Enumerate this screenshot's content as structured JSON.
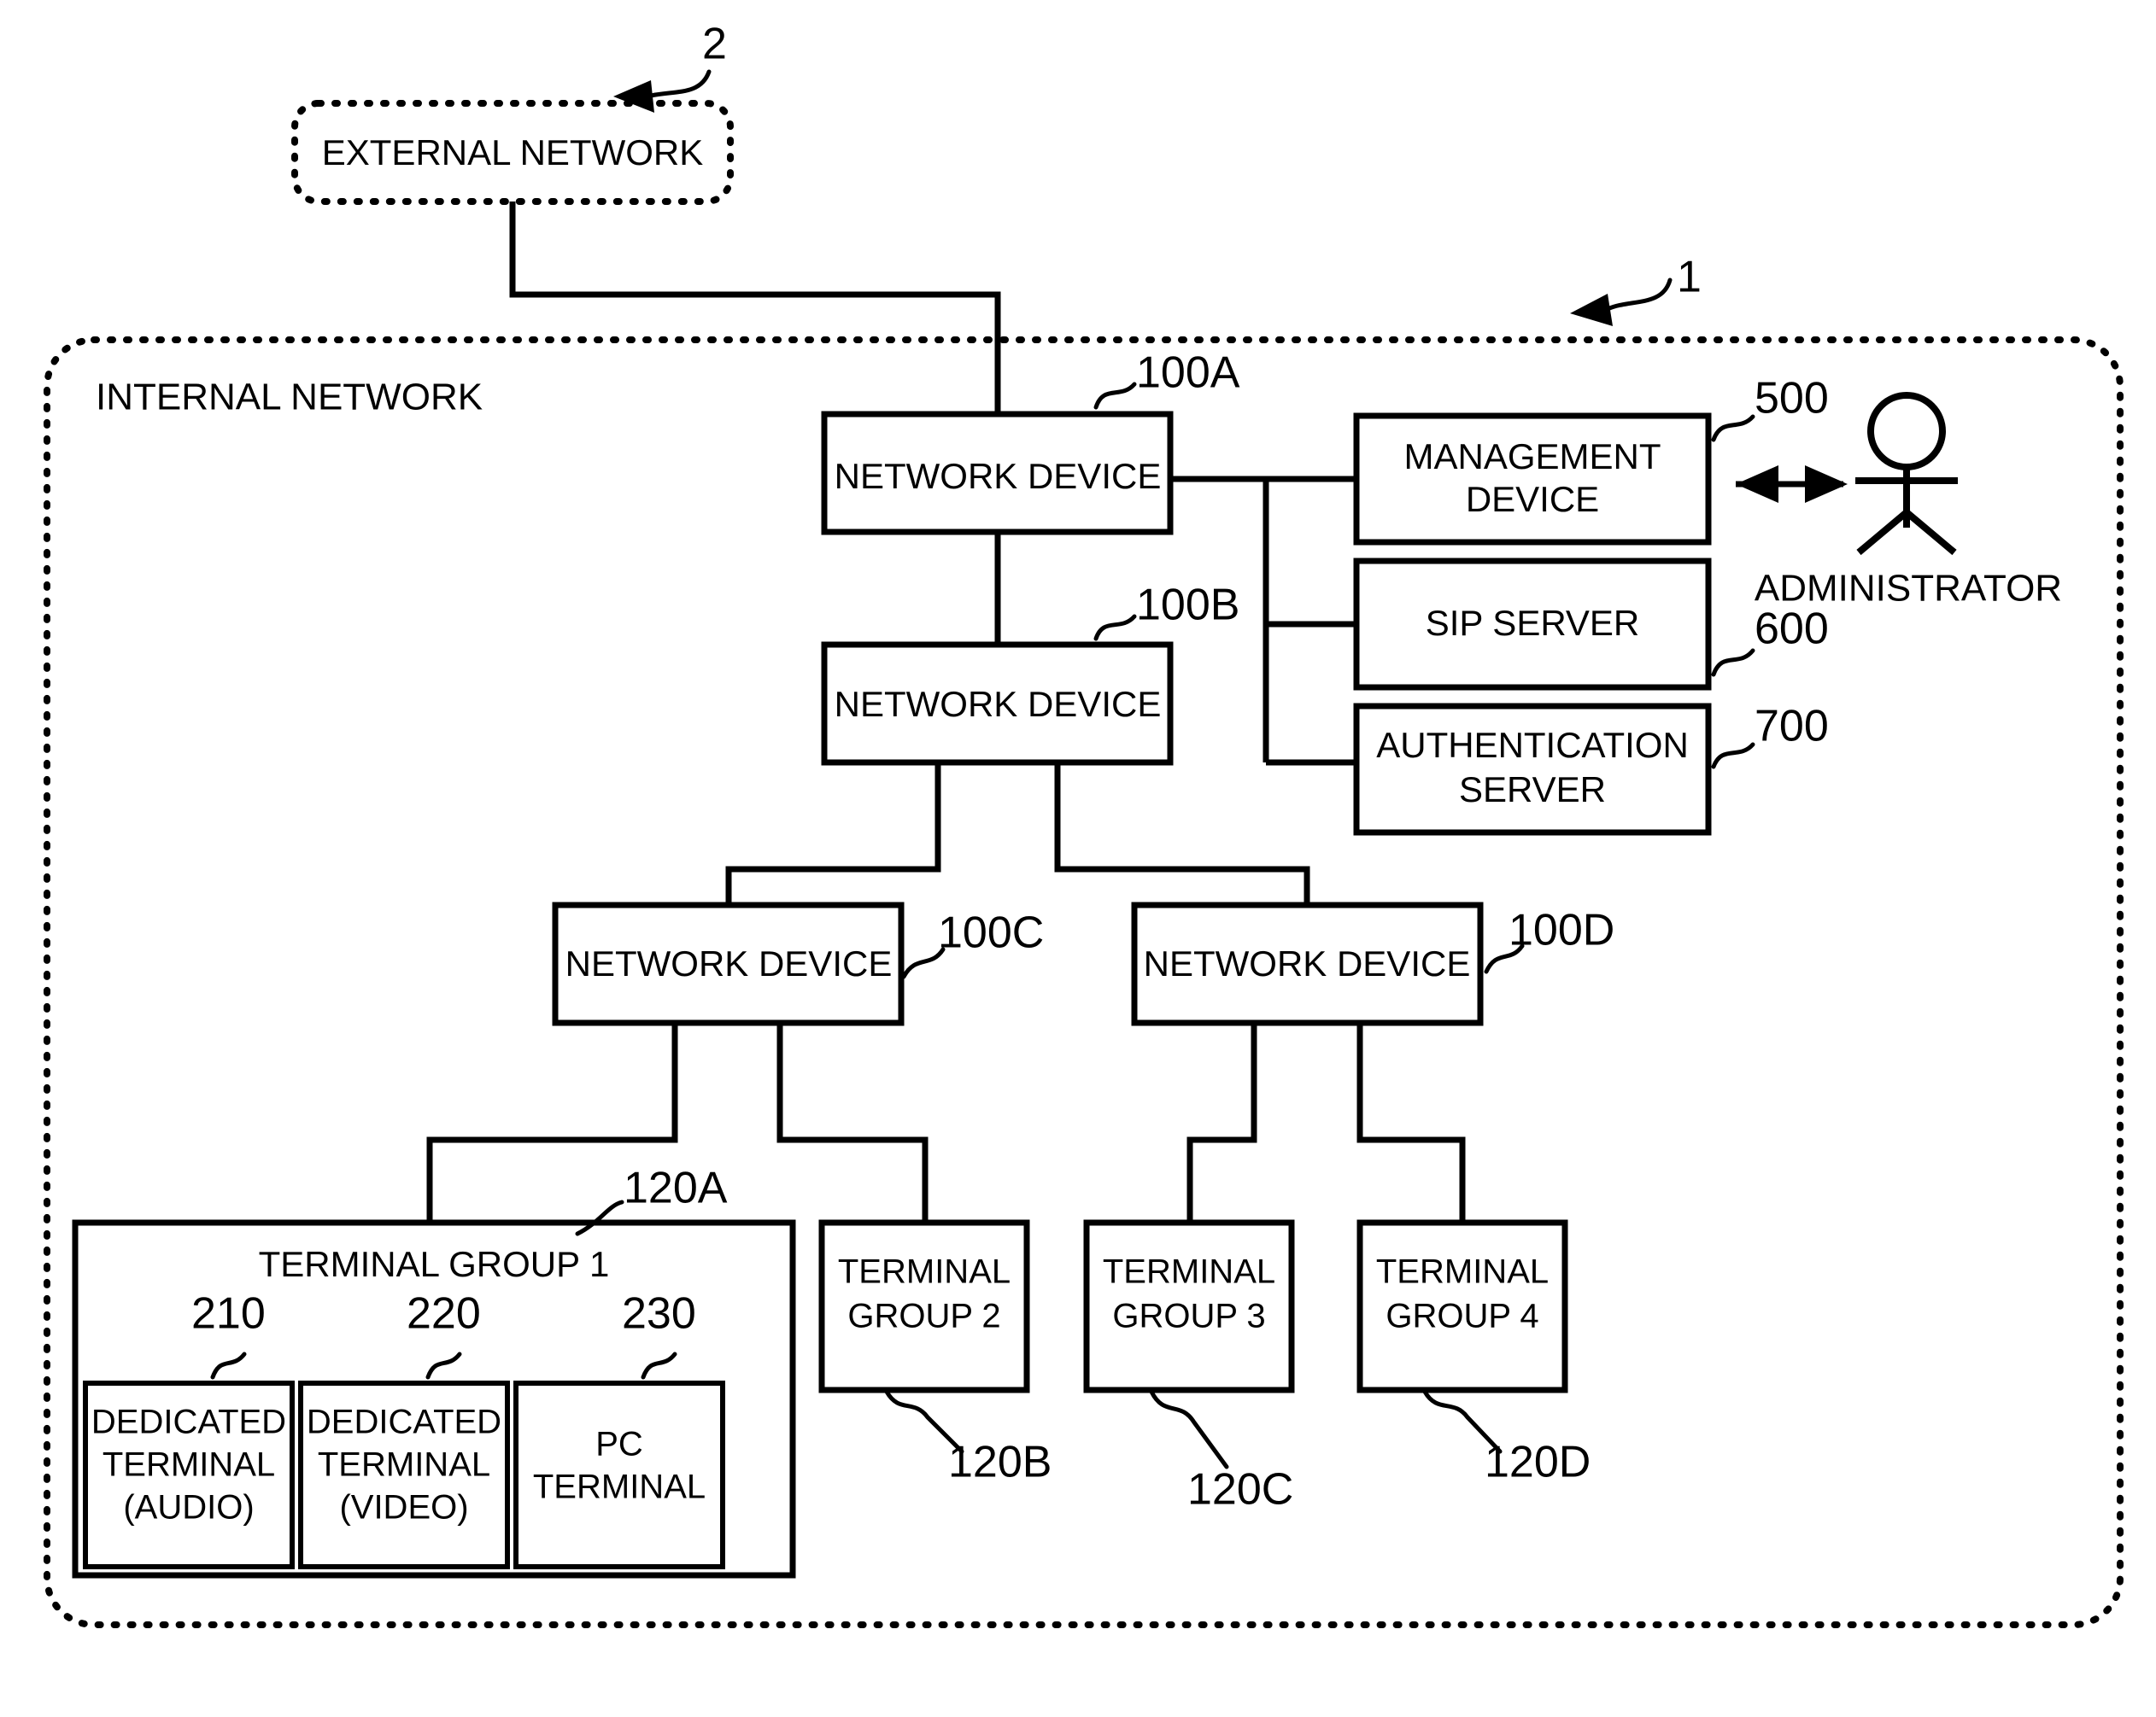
{
  "figure": {
    "external_network": {
      "label": "EXTERNAL NETWORK",
      "ref": "2"
    },
    "internal_network": {
      "label": "INTERNAL NETWORK",
      "ref": "1"
    },
    "network_devices": [
      {
        "label": "NETWORK DEVICE",
        "ref": "100A"
      },
      {
        "label": "NETWORK DEVICE",
        "ref": "100B"
      },
      {
        "label": "NETWORK DEVICE",
        "ref": "100C"
      },
      {
        "label": "NETWORK DEVICE",
        "ref": "100D"
      }
    ],
    "servers": [
      {
        "label_line1": "MANAGEMENT",
        "label_line2": "DEVICE",
        "ref": "500"
      },
      {
        "label_line1": "SIP SERVER",
        "label_line2": "",
        "ref": "600"
      },
      {
        "label_line1": "AUTHENTICATION",
        "label_line2": "SERVER",
        "ref": "700"
      }
    ],
    "administrator": {
      "label": "ADMINISTRATOR"
    },
    "terminal_groups": [
      {
        "label_line1": "TERMINAL GROUP 1",
        "label_line2": "",
        "ref": "120A"
      },
      {
        "label_line1": "TERMINAL",
        "label_line2": "GROUP 2",
        "ref": "120B"
      },
      {
        "label_line1": "TERMINAL",
        "label_line2": "GROUP 3",
        "ref": "120C"
      },
      {
        "label_line1": "TERMINAL",
        "label_line2": "GROUP 4",
        "ref": "120D"
      }
    ],
    "terminals": [
      {
        "line1": "DEDICATED",
        "line2": "TERMINAL",
        "line3": "(AUDIO)",
        "ref": "210"
      },
      {
        "line1": "DEDICATED",
        "line2": "TERMINAL",
        "line3": "(VIDEO)",
        "ref": "220"
      },
      {
        "line1": "PC",
        "line2": "TERMINAL",
        "line3": "",
        "ref": "230"
      }
    ],
    "colors": {
      "line": "#000000",
      "background": "#ffffff"
    }
  }
}
